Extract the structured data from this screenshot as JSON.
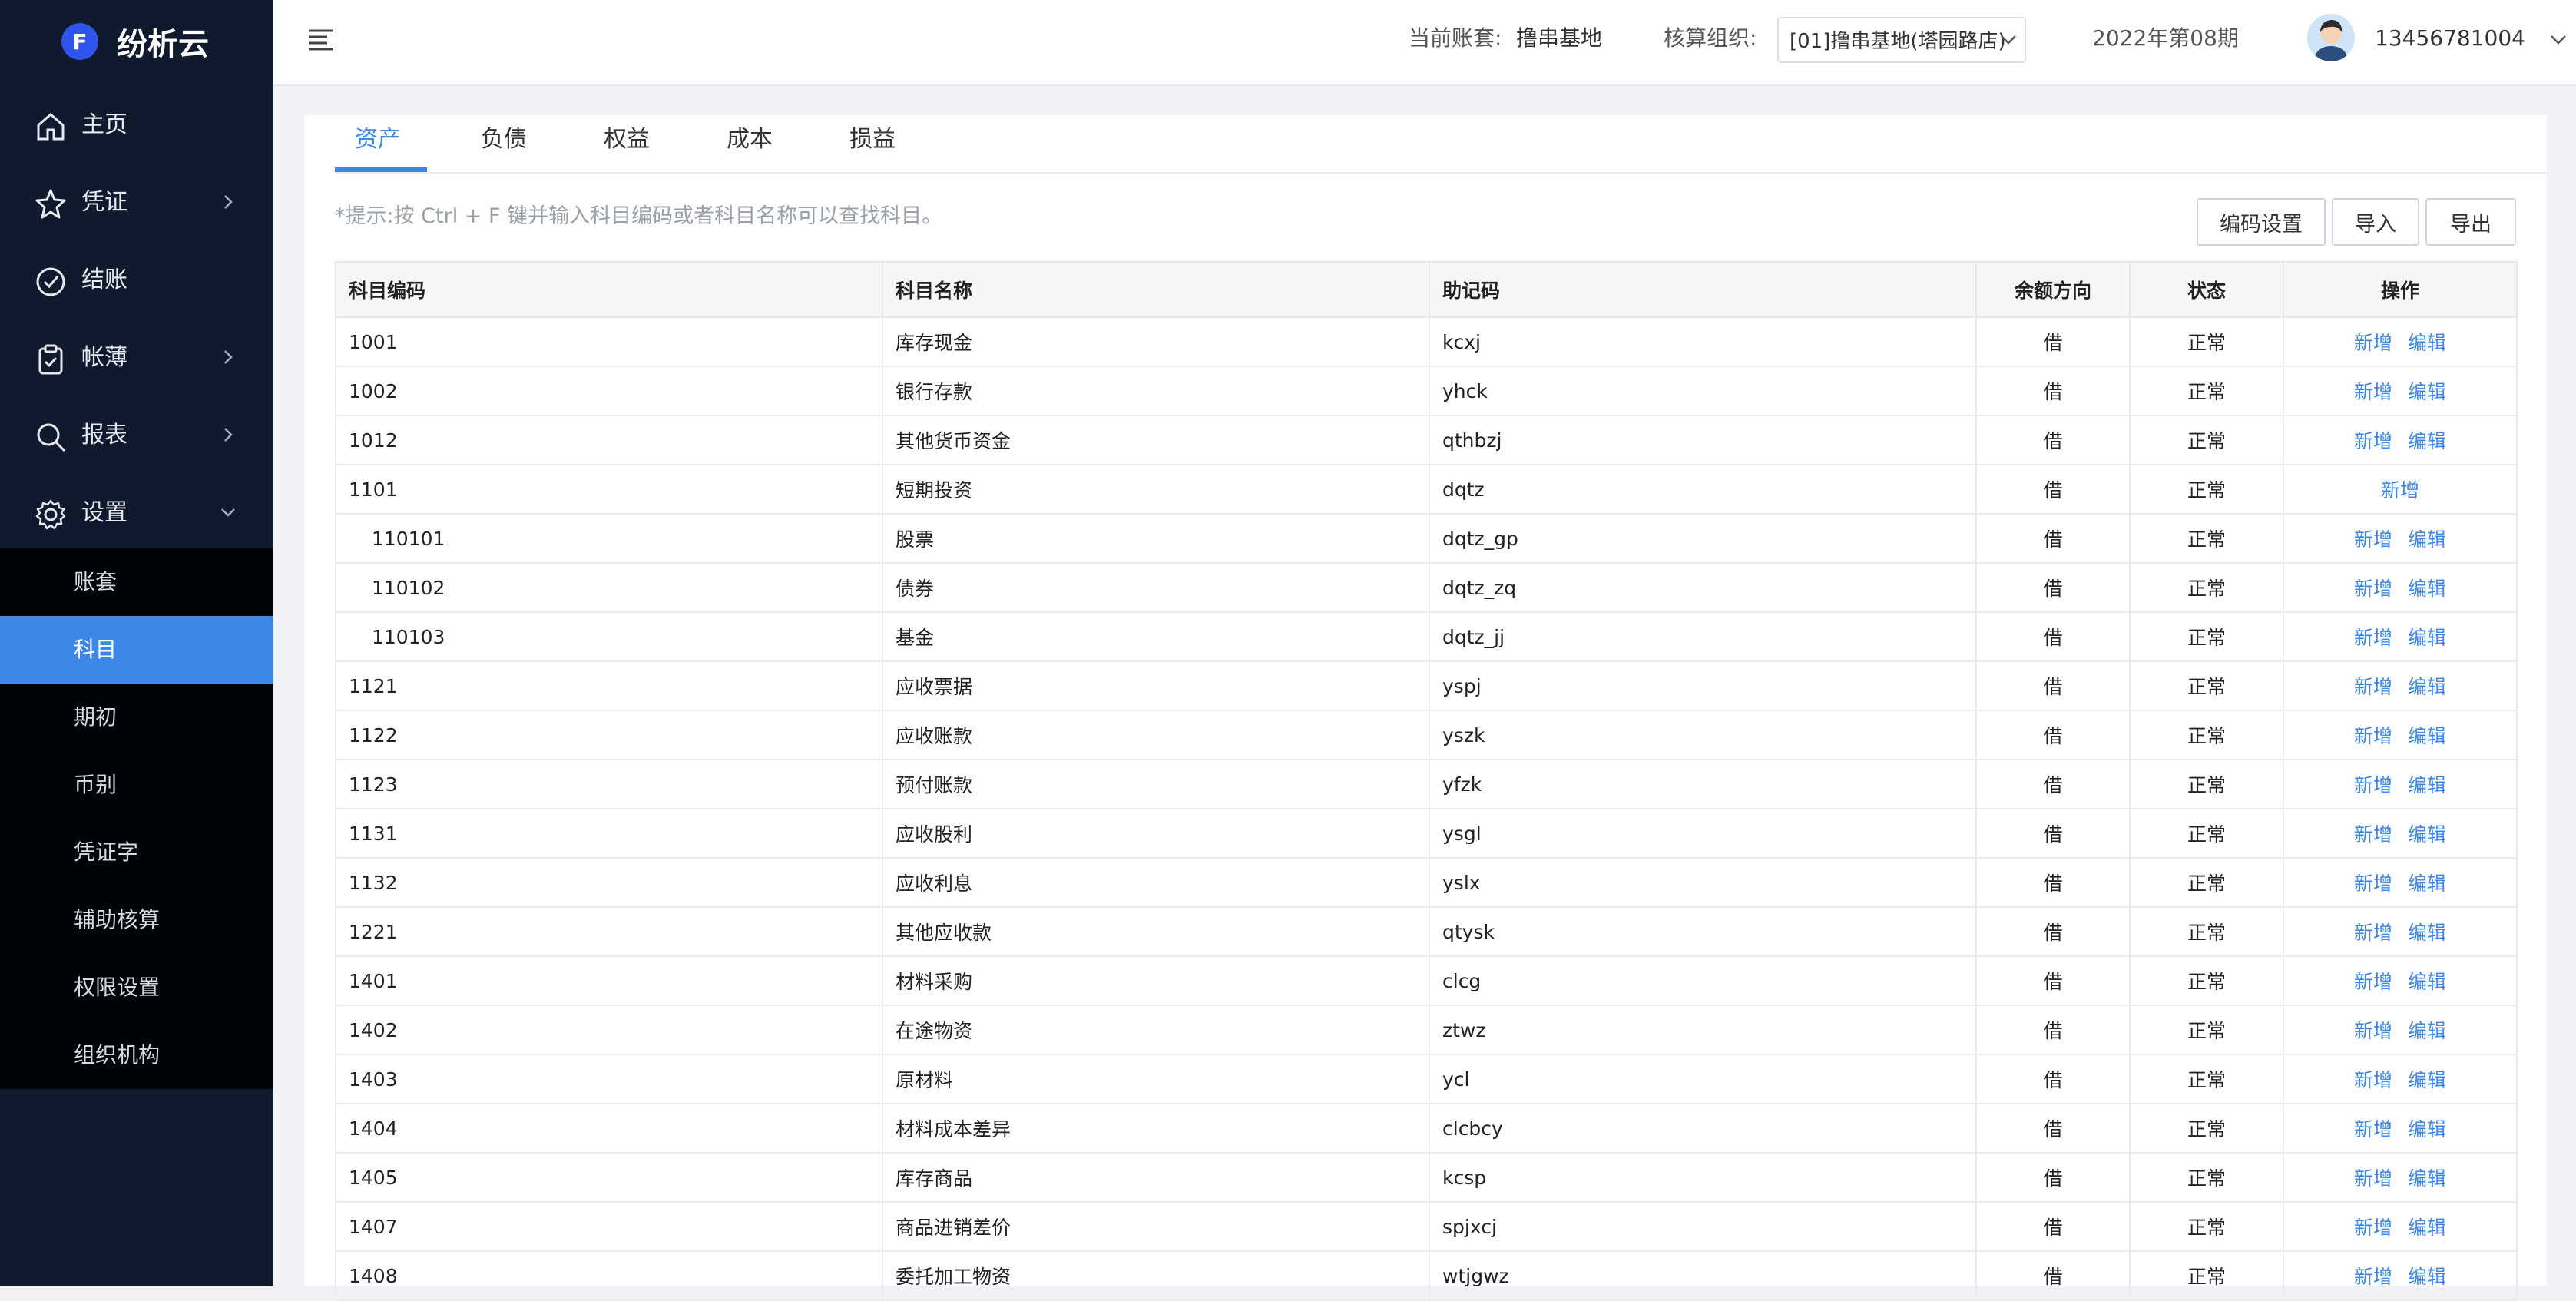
{
  "app": {
    "logo_letter": "F",
    "name": "纷析云"
  },
  "sidebar": {
    "items": [
      {
        "label": "主页",
        "icon": "home-icon",
        "has_arrow": false
      },
      {
        "label": "凭证",
        "icon": "star-icon",
        "has_arrow": true
      },
      {
        "label": "结账",
        "icon": "check-circle-icon",
        "has_arrow": false
      },
      {
        "label": "帐薄",
        "icon": "clipboard-check-icon",
        "has_arrow": true
      },
      {
        "label": "报表",
        "icon": "search-icon",
        "has_arrow": true
      },
      {
        "label": "设置",
        "icon": "gear-icon",
        "has_arrow": true,
        "expanded": true
      }
    ],
    "subitems": [
      {
        "label": "账套",
        "active": false
      },
      {
        "label": "科目",
        "active": true
      },
      {
        "label": "期初",
        "active": false
      },
      {
        "label": "币别",
        "active": false
      },
      {
        "label": "凭证字",
        "active": false
      },
      {
        "label": "辅助核算",
        "active": false
      },
      {
        "label": "权限设置",
        "active": false
      },
      {
        "label": "组织机构",
        "active": false
      }
    ]
  },
  "header": {
    "account_set_label": "当前账套:",
    "account_set_value": "撸串基地",
    "org_label": "核算组织:",
    "org_value": "[01]撸串基地(塔园路店)",
    "period": "2022年第08期",
    "user": "13456781004"
  },
  "tabs": [
    {
      "label": "资产",
      "active": true
    },
    {
      "label": "负债",
      "active": false
    },
    {
      "label": "权益",
      "active": false
    },
    {
      "label": "成本",
      "active": false
    },
    {
      "label": "损益",
      "active": false
    }
  ],
  "tip": "*提示:按 Ctrl + F 键并输入科目编码或者科目名称可以查找科目。",
  "buttons": {
    "code_settings": "编码设置",
    "import": "导入",
    "export": "导出"
  },
  "table": {
    "headers": [
      "科目编码",
      "科目名称",
      "助记码",
      "余额方向",
      "状态",
      "操作"
    ],
    "action_add": "新增",
    "action_edit": "编辑",
    "rows": [
      {
        "code": "1001",
        "name": "库存现金",
        "mnemonic": "kcxj",
        "direction": "借",
        "status": "正常",
        "editable": true,
        "child": false
      },
      {
        "code": "1002",
        "name": "银行存款",
        "mnemonic": "yhck",
        "direction": "借",
        "status": "正常",
        "editable": true,
        "child": false
      },
      {
        "code": "1012",
        "name": "其他货币资金",
        "mnemonic": "qthbzj",
        "direction": "借",
        "status": "正常",
        "editable": true,
        "child": false
      },
      {
        "code": "1101",
        "name": "短期投资",
        "mnemonic": "dqtz",
        "direction": "借",
        "status": "正常",
        "editable": false,
        "child": false
      },
      {
        "code": "110101",
        "name": "股票",
        "mnemonic": "dqtz_gp",
        "direction": "借",
        "status": "正常",
        "editable": true,
        "child": true
      },
      {
        "code": "110102",
        "name": "债券",
        "mnemonic": "dqtz_zq",
        "direction": "借",
        "status": "正常",
        "editable": true,
        "child": true
      },
      {
        "code": "110103",
        "name": "基金",
        "mnemonic": "dqtz_jj",
        "direction": "借",
        "status": "正常",
        "editable": true,
        "child": true
      },
      {
        "code": "1121",
        "name": "应收票据",
        "mnemonic": "yspj",
        "direction": "借",
        "status": "正常",
        "editable": true,
        "child": false
      },
      {
        "code": "1122",
        "name": "应收账款",
        "mnemonic": "yszk",
        "direction": "借",
        "status": "正常",
        "editable": true,
        "child": false
      },
      {
        "code": "1123",
        "name": "预付账款",
        "mnemonic": "yfzk",
        "direction": "借",
        "status": "正常",
        "editable": true,
        "child": false
      },
      {
        "code": "1131",
        "name": "应收股利",
        "mnemonic": "ysgl",
        "direction": "借",
        "status": "正常",
        "editable": true,
        "child": false
      },
      {
        "code": "1132",
        "name": "应收利息",
        "mnemonic": "yslx",
        "direction": "借",
        "status": "正常",
        "editable": true,
        "child": false
      },
      {
        "code": "1221",
        "name": "其他应收款",
        "mnemonic": "qtysk",
        "direction": "借",
        "status": "正常",
        "editable": true,
        "child": false
      },
      {
        "code": "1401",
        "name": "材料采购",
        "mnemonic": "clcg",
        "direction": "借",
        "status": "正常",
        "editable": true,
        "child": false
      },
      {
        "code": "1402",
        "name": "在途物资",
        "mnemonic": "ztwz",
        "direction": "借",
        "status": "正常",
        "editable": true,
        "child": false
      },
      {
        "code": "1403",
        "name": "原材料",
        "mnemonic": "ycl",
        "direction": "借",
        "status": "正常",
        "editable": true,
        "child": false
      },
      {
        "code": "1404",
        "name": "材料成本差异",
        "mnemonic": "clcbcy",
        "direction": "借",
        "status": "正常",
        "editable": true,
        "child": false
      },
      {
        "code": "1405",
        "name": "库存商品",
        "mnemonic": "kcsp",
        "direction": "借",
        "status": "正常",
        "editable": true,
        "child": false
      },
      {
        "code": "1407",
        "name": "商品进销差价",
        "mnemonic": "spjxcj",
        "direction": "借",
        "status": "正常",
        "editable": true,
        "child": false
      },
      {
        "code": "1408",
        "name": "委托加工物资",
        "mnemonic": "wtjgwz",
        "direction": "借",
        "status": "正常",
        "editable": true,
        "child": false
      }
    ]
  },
  "colors": {
    "sidebar_bg": "#0f1a2e",
    "submenu_bg": "#000308",
    "accent": "#3d87e6"
  }
}
